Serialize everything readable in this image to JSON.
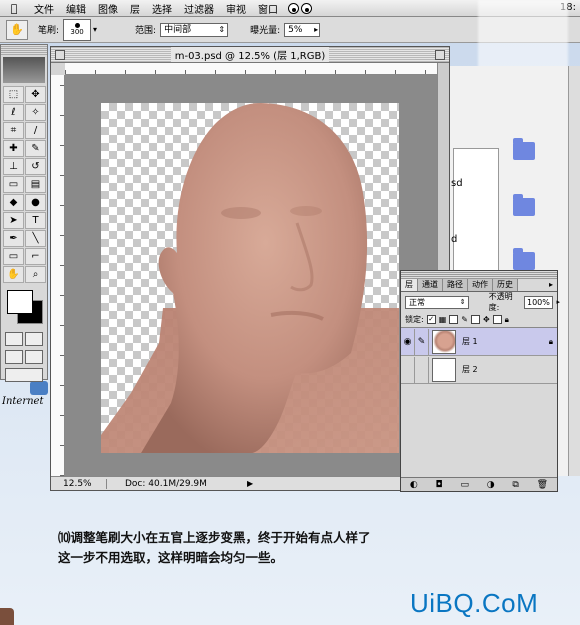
{
  "menubar": {
    "apple": "",
    "items": [
      "文件",
      "编辑",
      "图像",
      "层",
      "选择",
      "过滤器",
      "审视",
      "窗口"
    ],
    "clock": "18:"
  },
  "options": {
    "brush_label": "笔刷:",
    "brush_size": "300",
    "range_label": "范围:",
    "range_value": "中间部",
    "exposure_label": "曝光量:",
    "exposure_value": "5%"
  },
  "document": {
    "title": "m-03.psd @ 12.5% (层 1,RGB)",
    "zoom": "12.5%",
    "docsize": "Doc: 40.1M/29.9M"
  },
  "explorer": {
    "frag1": "sd",
    "frag2": "d"
  },
  "desktop": {
    "internet_label": "Internet"
  },
  "layers": {
    "tabs": [
      "层",
      "通道",
      "路径",
      "动作",
      "历史"
    ],
    "blend_mode": "正常",
    "opacity_label": "不透明度:",
    "opacity_value": "100%",
    "lock_label": "锁定:",
    "layer_list": [
      {
        "name": "层 1",
        "selected": true
      },
      {
        "name": "层 2",
        "selected": false
      }
    ]
  },
  "caption": {
    "line1": "⑽调整笔刷大小在五官上逐步变黑，终于开始有点人样了",
    "line2": "这一步不用选取，这样明暗会均匀一些。"
  },
  "brand": "UiBQ.CoM",
  "colors": {
    "brand": "#0a76c2",
    "skin": "#c9988a",
    "selected_layer": "#c9c9ec"
  }
}
